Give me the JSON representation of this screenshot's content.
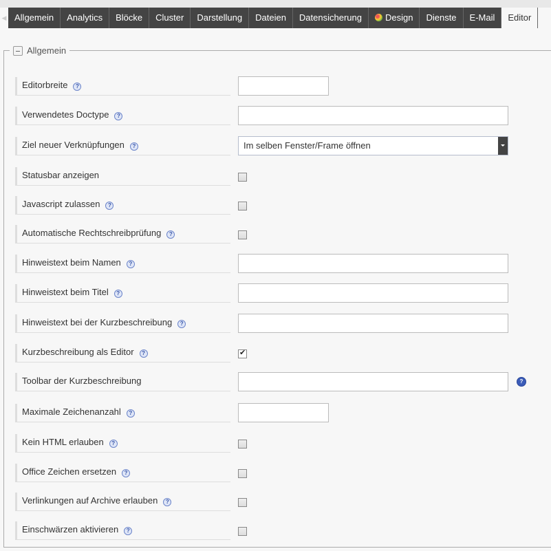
{
  "tabs": [
    {
      "label": "Allgemein"
    },
    {
      "label": "Analytics"
    },
    {
      "label": "Blöcke"
    },
    {
      "label": "Cluster"
    },
    {
      "label": "Darstellung"
    },
    {
      "label": "Dateien"
    },
    {
      "label": "Datensicherung"
    },
    {
      "label": "Design",
      "icon": "palette-icon"
    },
    {
      "label": "Dienste"
    },
    {
      "label": "E-Mail"
    },
    {
      "label": "Editor",
      "active": true
    }
  ],
  "fieldset": {
    "legend": "Allgemein"
  },
  "rows": [
    {
      "label": "Editorbreite",
      "help": true,
      "control": "text-small",
      "value": ""
    },
    {
      "label": "Verwendetes Doctype",
      "help": true,
      "control": "text-wide",
      "value": ""
    },
    {
      "label": "Ziel neuer Verknüpfungen",
      "help": true,
      "control": "select",
      "value": "Im selben Fenster/Frame öffnen"
    },
    {
      "label": "Statusbar anzeigen",
      "help": false,
      "control": "checkbox",
      "checked": false
    },
    {
      "label": "Javascript zulassen",
      "help": true,
      "control": "checkbox",
      "checked": false
    },
    {
      "label": "Automatische Rechtschreibprüfung",
      "help": true,
      "control": "checkbox",
      "checked": false
    },
    {
      "label": "Hinweistext beim Namen",
      "help": true,
      "control": "text-wide",
      "value": ""
    },
    {
      "label": "Hinweistext beim Titel",
      "help": true,
      "control": "text-wide",
      "value": ""
    },
    {
      "label": "Hinweistext bei der Kurzbeschreibung",
      "help": true,
      "control": "text-wide",
      "value": ""
    },
    {
      "label": "Kurzbeschreibung als Editor",
      "help": true,
      "control": "checkbox",
      "checked": true
    },
    {
      "label": "Toolbar der Kurzbeschreibung",
      "help": false,
      "control": "text-wide",
      "value": "",
      "help_after": true
    },
    {
      "label": "Maximale Zeichenanzahl",
      "help": true,
      "control": "text-small",
      "value": ""
    },
    {
      "label": "Kein HTML erlauben",
      "help": true,
      "control": "checkbox",
      "checked": false
    },
    {
      "label": "Office Zeichen ersetzen",
      "help": true,
      "control": "checkbox",
      "checked": false
    },
    {
      "label": "Verlinkungen auf Archive erlauben",
      "help": true,
      "control": "checkbox",
      "checked": false
    },
    {
      "label": "Einschwärzen aktivieren",
      "help": true,
      "control": "checkbox",
      "checked": false
    }
  ],
  "help_glyph": "?"
}
